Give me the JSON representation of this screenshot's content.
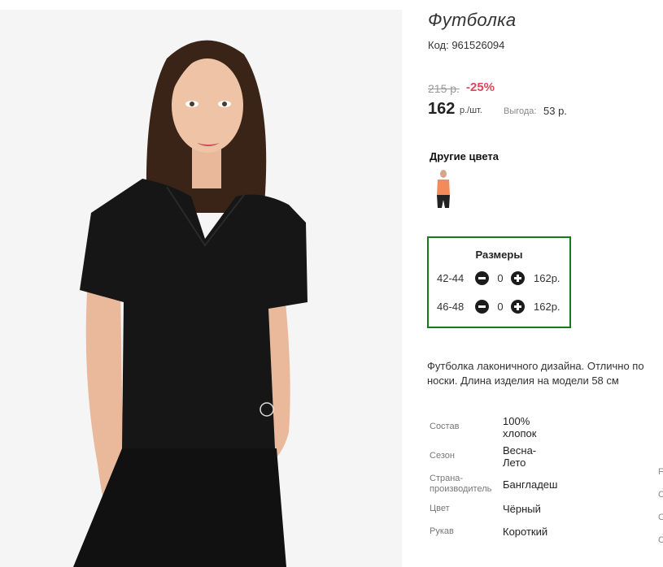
{
  "product": {
    "title": "Футболка",
    "sku": "Код: 961526094",
    "old_price": "215 р.",
    "discount": "-25%",
    "price": "162",
    "unit": "р./шт.",
    "benefit_label": "Выгода:",
    "benefit_value": "53 р."
  },
  "other_colors": {
    "heading": "Другие цвета",
    "swatch_color": "#f28a5a"
  },
  "sizes": {
    "heading": "Размеры",
    "rows": [
      {
        "size": "42-44",
        "qty": "0",
        "price": "162р."
      },
      {
        "size": "46-48",
        "qty": "0",
        "price": "162р."
      }
    ]
  },
  "description": {
    "line1": "Футболка лаконичного дизайна. Отлично по",
    "line2": "носки. Длина изделия на модели 58 см"
  },
  "specs": [
    {
      "label": "Состав",
      "value_line1": "100%",
      "value_line2": "хлопок"
    },
    {
      "label": "Сезон",
      "value_line1": "Весна-",
      "value_line2": "Лето"
    },
    {
      "label_line1": "Страна-",
      "label_line2": "производитель",
      "value": "Бангладеш"
    },
    {
      "label": "Цвет",
      "value": "Чёрный"
    },
    {
      "label": "Рукав",
      "value": "Короткий"
    }
  ],
  "edge_chars": [
    "F",
    "С",
    "С",
    "С"
  ],
  "colors": {
    "discount": "#e0455c",
    "sizes_border": "#157a1a",
    "garment": "#161616"
  }
}
